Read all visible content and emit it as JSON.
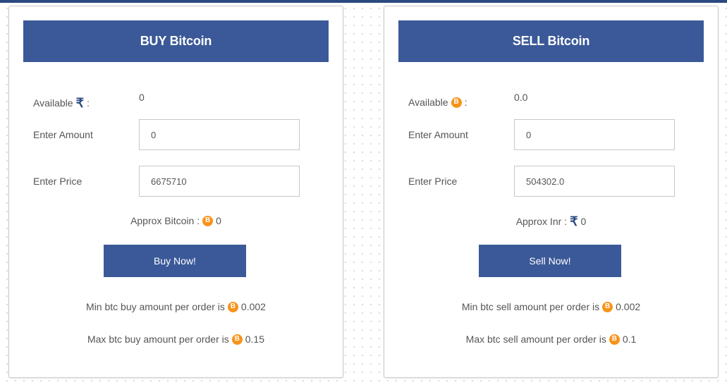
{
  "buy": {
    "title": "BUY Bitcoin",
    "available_label": "Available",
    "available_separator": ":",
    "available_value": "0",
    "amount_label": "Enter Amount",
    "amount_value": "0",
    "price_label": "Enter Price",
    "price_value": "6675710",
    "approx_label": "Approx Bitcoin :",
    "approx_value": "0",
    "button_label": "Buy Now!",
    "min_text": "Min btc buy amount per order is",
    "min_value": "0.002",
    "max_text": "Max btc buy amount per order is",
    "max_value": "0.15"
  },
  "sell": {
    "title": "SELL Bitcoin",
    "available_label": "Available",
    "available_separator": ":",
    "available_value": "0.0",
    "amount_label": "Enter Amount",
    "amount_value": "0",
    "price_label": "Enter Price",
    "price_value": "504302.0",
    "approx_label": "Approx Inr :",
    "approx_value": "0",
    "button_label": "Sell Now!",
    "min_text": "Min btc sell amount per order is",
    "min_value": "0.002",
    "max_text": "Max btc sell amount per order is",
    "max_value": "0.1"
  },
  "icons": {
    "rupee": "rupee-icon",
    "bitcoin": "bitcoin-icon",
    "rupee_glyph": "₹",
    "bitcoin_glyph": "B"
  },
  "colors": {
    "header": "#3b5998",
    "button": "#3b5998",
    "bitcoin": "#f7931a",
    "rupee": "#2b4a80"
  }
}
